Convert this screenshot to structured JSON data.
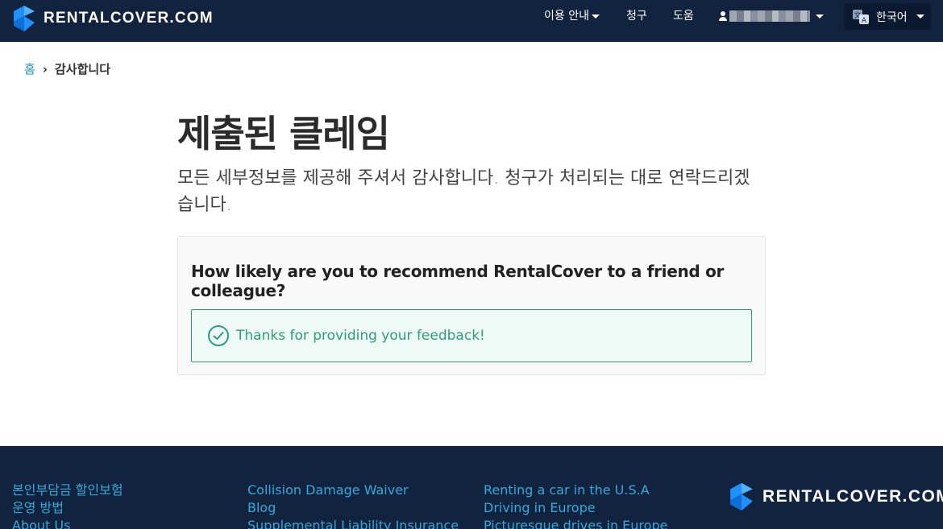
{
  "header": {
    "brand": "RENTALCOVER.COM",
    "nav": {
      "guide": "이용 안내",
      "claims": "청구",
      "help": "도움"
    },
    "language": "한국어"
  },
  "breadcrumb": {
    "home": "홈",
    "separator": "›",
    "current": "감사합니다"
  },
  "main": {
    "title": "제출된 클레임",
    "subtitle": "모든 세부정보를 제공해 주셔서 감사합니다. 청구가 처리되는 대로 연락드리겠습니다.",
    "survey": {
      "question": "How likely are you to recommend RentalCover to a friend or colleague?",
      "success_message": "Thanks for providing your feedback!"
    }
  },
  "footer": {
    "col1": [
      "본인부담금 할인보험",
      "운영 방법",
      "About Us"
    ],
    "col2": [
      "Collision Damage Waiver",
      "Blog",
      "Supplemental Liability Insurance"
    ],
    "col3": [
      "Renting a car in the U.S.A",
      "Driving in Europe",
      "Picturesque drives in Europe"
    ],
    "brand": "RENTALCOVER.COM"
  },
  "colors": {
    "navy": "#122340",
    "link_blue": "#34a9d8",
    "success_green": "#2b9e7c",
    "brand_blue": "#1e90ff"
  }
}
